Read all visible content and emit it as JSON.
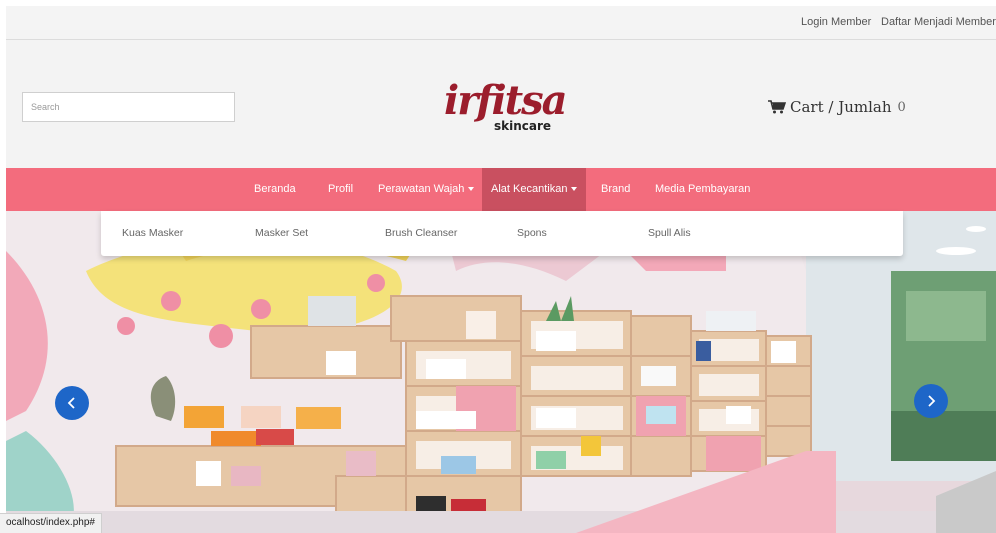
{
  "topbar": {
    "login_label": "Login Member",
    "register_label": "Daftar Menjadi Member"
  },
  "header": {
    "search_placeholder": "Search",
    "logo_script": "irfitsa",
    "logo_sub": "skincare",
    "cart_label": "Cart / Jumlah",
    "cart_count": "0"
  },
  "nav": {
    "items": [
      {
        "label": "Beranda"
      },
      {
        "label": "Profil"
      },
      {
        "label": "Perawatan Wajah"
      },
      {
        "label": "Alat Kecantikan"
      },
      {
        "label": "Brand"
      },
      {
        "label": "Media Pembayaran"
      }
    ],
    "active_index": 3
  },
  "dropdown": {
    "items": [
      {
        "label": "Kuas Masker"
      },
      {
        "label": "Masker Set"
      },
      {
        "label": "Brush Cleanser"
      },
      {
        "label": "Spons"
      },
      {
        "label": "Spull Alis"
      }
    ]
  },
  "carousel": {
    "prev_icon": "chevron-left-icon",
    "next_icon": "chevron-right-icon"
  },
  "status_bar": {
    "url": "ocalhost/index.php#"
  },
  "colors": {
    "nav_background": "#f36c7d",
    "nav_active": "#c95060",
    "carousel_button": "#1e66c8",
    "logo": "#9b1d2c"
  }
}
